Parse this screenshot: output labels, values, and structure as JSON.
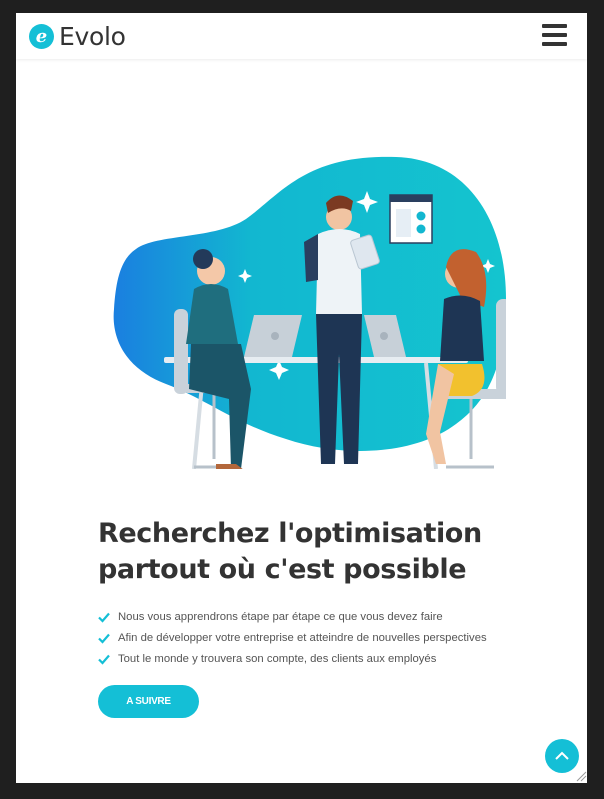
{
  "brand": {
    "logo_letter": "e",
    "name": "Evolo"
  },
  "navbar": {
    "menu_icon": "hamburger-menu-icon"
  },
  "hero": {
    "headline_line1": "Recherchez l'optimisation",
    "headline_line2": "partout où c'est possible",
    "features": [
      "Nous vous apprendrons étape par étape ce que vous devez faire",
      "Afin de développer votre entreprise et atteindre de nouvelles perspectives",
      "Tout le monde y trouvera son compte, des clients aux employés"
    ],
    "cta_label": "A SUIVRE"
  },
  "colors": {
    "accent": "#14bfd6",
    "heading": "#333333",
    "body_text": "#555555"
  }
}
